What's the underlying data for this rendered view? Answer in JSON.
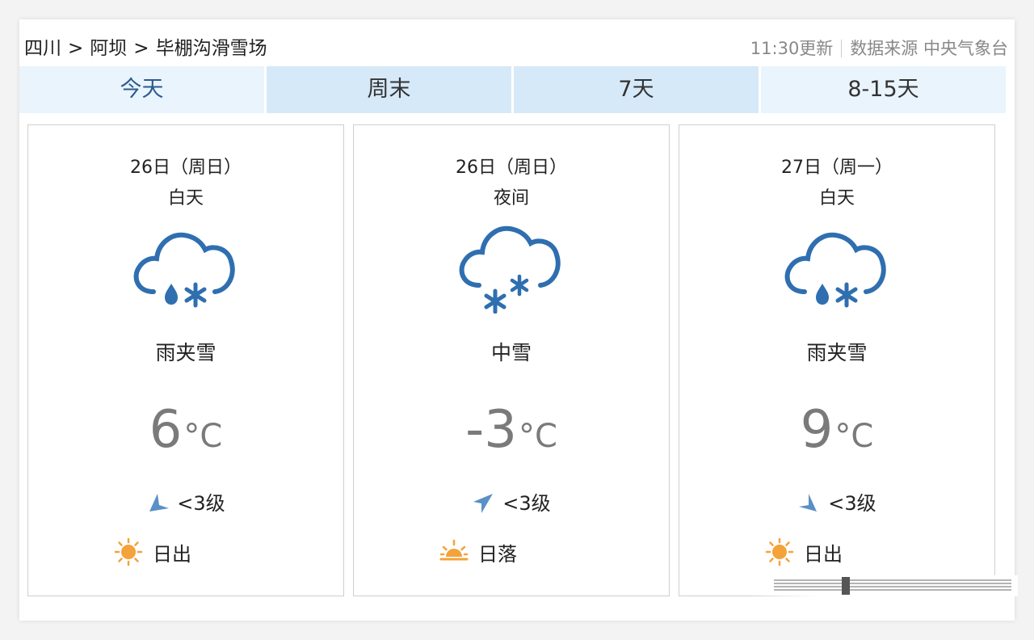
{
  "breadcrumb": {
    "province": "四川",
    "region": "阿坝",
    "place": "毕棚沟滑雪场",
    "separator": ">"
  },
  "meta": {
    "updated": "11:30更新",
    "source_label": "数据来源",
    "source": "中央气象台"
  },
  "tabs": [
    {
      "label": "今天",
      "active": true
    },
    {
      "label": "周末",
      "active": false
    },
    {
      "label": "7天",
      "active": false
    },
    {
      "label": "8-15天",
      "active": false
    }
  ],
  "cards": [
    {
      "date": "26日（周日）",
      "period": "白天",
      "icon": "rain-snow-icon",
      "weather": "雨夹雪",
      "temp": "6",
      "unit": "°C",
      "wind_icon": "wind-direction-icon",
      "wind": "<3级",
      "sun_icon": "sunrise-icon",
      "sun": "日出"
    },
    {
      "date": "26日（周日）",
      "period": "夜间",
      "icon": "snow-icon",
      "weather": "中雪",
      "temp": "-3",
      "unit": "°C",
      "wind_icon": "wind-direction-icon",
      "wind": "<3级",
      "sun_icon": "sunset-icon",
      "sun": "日落"
    },
    {
      "date": "27日（周一）",
      "period": "白天",
      "icon": "rain-snow-icon",
      "weather": "雨夹雪",
      "temp": "9",
      "unit": "°C",
      "wind_icon": "wind-direction-icon",
      "wind": "<3级",
      "sun_icon": "sunrise-icon",
      "sun": "日出"
    }
  ],
  "colors": {
    "tab_bg": "#d6e9f9",
    "tab_active_bg": "#eaf4fd",
    "tab_active_text": "#2c5a8e",
    "icon_blue": "#2f6fb0",
    "sun_orange": "#f3a33a",
    "temp_gray": "#7a7a7a"
  }
}
